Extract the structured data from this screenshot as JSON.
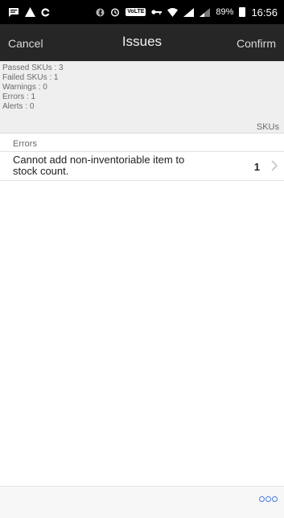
{
  "status_bar": {
    "battery_percent": "89%",
    "time": "16:56",
    "volte_label": "VoLTE",
    "icons": [
      "message-icon",
      "warning-icon",
      "sync-icon",
      "bluetooth-icon",
      "alarm-icon",
      "volte-icon",
      "vpn-key-icon",
      "wifi-icon",
      "signal-icon",
      "signal-icon",
      "battery-icon"
    ]
  },
  "nav": {
    "cancel_label": "Cancel",
    "title": "Issues",
    "confirm_label": "Confirm"
  },
  "summary": {
    "passed_skus": "Passed SKUs : 3",
    "failed_skus": "Failed SKUs : 1",
    "warnings": "Warnings : 0",
    "errors": "Errors : 1",
    "alerts": "Alerts : 0"
  },
  "table": {
    "column_header": "SKUs",
    "section_title": "Errors",
    "rows": [
      {
        "message": "Cannot add non-inventoriable item to stock count.",
        "count": "1"
      }
    ]
  },
  "colors": {
    "nav_background": "#262626",
    "accent": "#4b7bd9"
  }
}
